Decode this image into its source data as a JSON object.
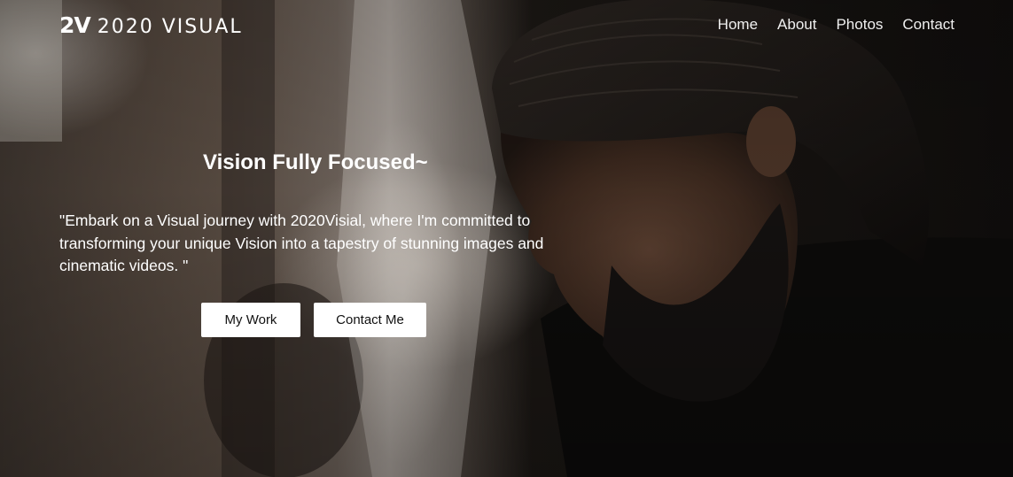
{
  "brand": {
    "mark": "2V",
    "name": "2020 VISUAL"
  },
  "nav": {
    "items": [
      {
        "label": "Home"
      },
      {
        "label": "About"
      },
      {
        "label": "Photos"
      },
      {
        "label": "Contact"
      }
    ]
  },
  "hero": {
    "headline": "Vision Fully Focused~",
    "tagline": "\"Embark on a Visual journey with 2020Visial, where I'm committed to transforming your unique Vision into a tapestry of stunning images and cinematic videos. \"",
    "buttons": {
      "primary": "My Work",
      "secondary": "Contact Me"
    }
  },
  "colors": {
    "text": "#ffffff",
    "button_bg": "#ffffff",
    "button_text": "#111111"
  }
}
